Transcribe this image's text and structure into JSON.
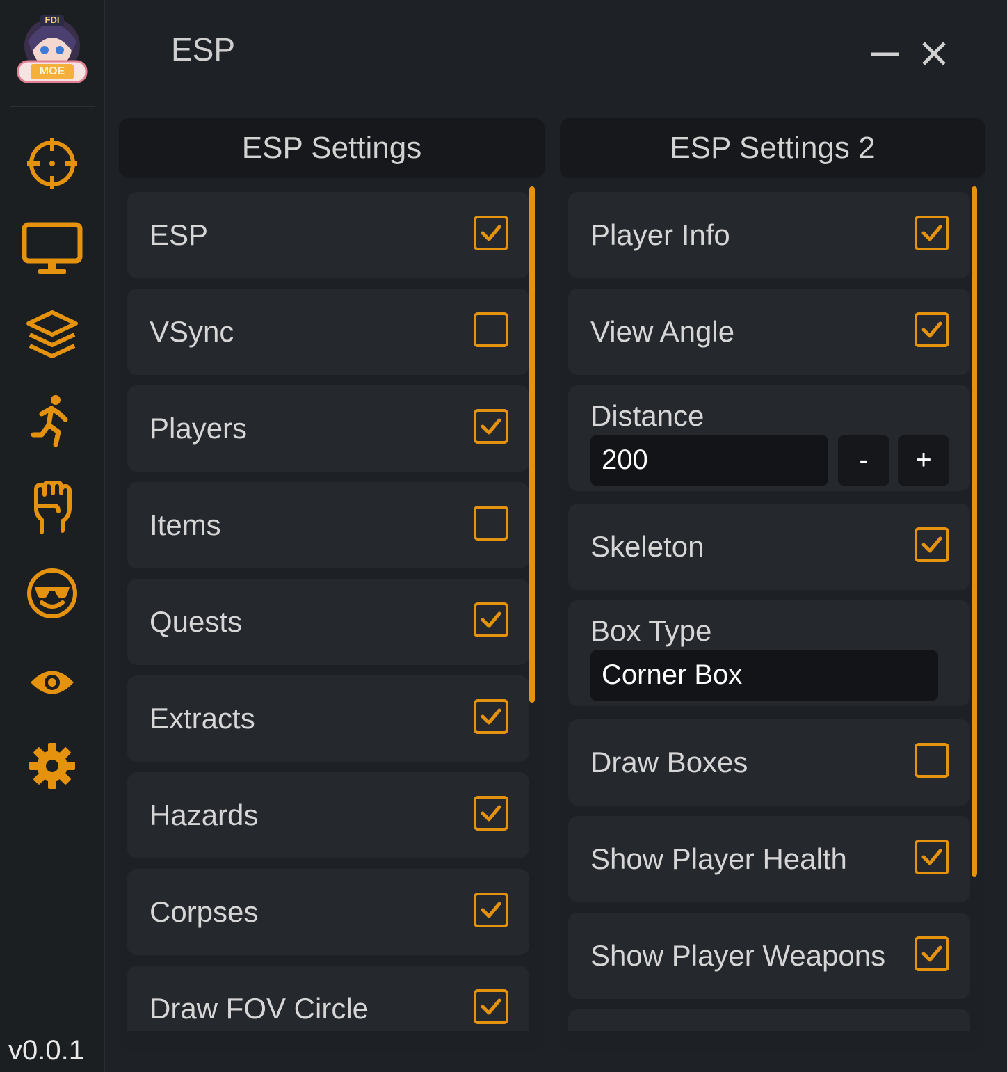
{
  "window": {
    "title": "ESP",
    "version": "v0.0.1",
    "accent": "#e5930f",
    "logo_text_top": "FDI",
    "logo_text": "MOE"
  },
  "sidebar": {
    "items": [
      {
        "icon": "crosshair-icon"
      },
      {
        "icon": "monitor-icon"
      },
      {
        "icon": "layers-icon"
      },
      {
        "icon": "running-person-icon"
      },
      {
        "icon": "fist-icon"
      },
      {
        "icon": "sunglasses-face-icon"
      },
      {
        "icon": "eye-icon"
      },
      {
        "icon": "gear-icon"
      }
    ]
  },
  "left_panel": {
    "title": "ESP Settings",
    "items": [
      {
        "label": "ESP",
        "checked": true
      },
      {
        "label": "VSync",
        "checked": false
      },
      {
        "label": "Players",
        "checked": true
      },
      {
        "label": "Items",
        "checked": false
      },
      {
        "label": "Quests",
        "checked": true
      },
      {
        "label": "Extracts",
        "checked": true
      },
      {
        "label": "Hazards",
        "checked": true
      },
      {
        "label": "Corpses",
        "checked": true
      },
      {
        "label": "Draw FOV Circle",
        "checked": true
      }
    ]
  },
  "right_panel": {
    "title": "ESP Settings 2",
    "player_info": {
      "label": "Player Info",
      "checked": true
    },
    "view_angle": {
      "label": "View Angle",
      "checked": true
    },
    "distance": {
      "label": "Distance",
      "value": "200",
      "minus": "-",
      "plus": "+"
    },
    "skeleton": {
      "label": "Skeleton",
      "checked": true
    },
    "box_type": {
      "label": "Box Type",
      "value": "Corner Box"
    },
    "draw_boxes": {
      "label": "Draw Boxes",
      "checked": false
    },
    "show_health": {
      "label": "Show Player Health",
      "checked": true
    },
    "show_weapons": {
      "label": "Show Player Weapons",
      "checked": true
    }
  }
}
